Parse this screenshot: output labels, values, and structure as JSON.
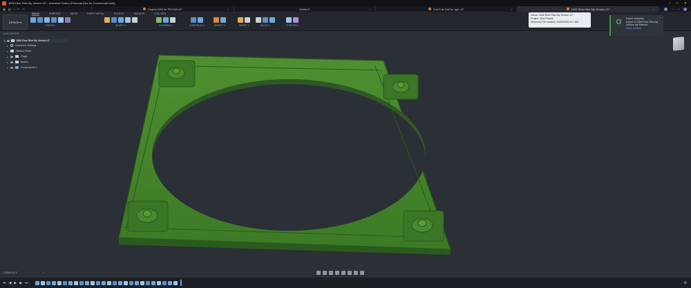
{
  "window": {
    "title": "1606 Rear Ribs My Version v2* - Autodesk Fusion (Personal (Not for Commercial Use))"
  },
  "tabs": [
    {
      "label": "Dayton DS4 for PM Grill v2*",
      "active": false
    },
    {
      "label": "Untitled*",
      "active": false
    },
    {
      "label": "Sch Folk Grill for Igor v7*",
      "active": false
    },
    {
      "label": "1606 Rear Ribs My Version v2*",
      "active": true
    }
  ],
  "ribbon": {
    "workspace": "DESIGN",
    "tabs": [
      "SOLID",
      "SURFACE",
      "MESH",
      "SHEET METAL",
      "PLASTIC",
      "MANAGE",
      "UTILITIES"
    ],
    "active_tab": "SOLID",
    "groups": [
      "CREATE",
      "MODIFY",
      "ASSEMBLE",
      "CONSTRUCT",
      "INSPECT",
      "INSERT",
      "SELECT",
      "POSITION"
    ],
    "groups_display": [
      "CREATE ▾",
      "MODIFY ▾",
      "ASSEMBLE ▾",
      "CONSTRUCT ▾",
      "INSPECT ▾",
      "INSERT ▾",
      "SELECT ▾",
      "POSITION ▾"
    ],
    "group_colors": [
      "#6fa8dc",
      "#e0b050",
      "#7bbf6a",
      "#d98a3a",
      "#c9cfd6",
      "#5aa9ff",
      "#9fc5e8",
      "#b58ad8"
    ]
  },
  "recovery": {
    "name": "Name: 1606 Rear Ribs My Version v2*",
    "project": "Project: New Project",
    "created": "Recovery File created: 12/26/2025 4:17 AM"
  },
  "export_toast": {
    "title": "Export complete",
    "message": "Export of 1606 Rear Ribs My Version.stp finished.",
    "link": "Open location",
    "close": "×"
  },
  "browser": {
    "header": "BROWSER",
    "root": "1606 Rear Ribs My Version v2",
    "items": [
      "Document Settings",
      "Named Views",
      "Origin",
      "Bodies",
      "Component1:1"
    ]
  },
  "comments": {
    "label": "COMMENTS",
    "plus": "+"
  },
  "icons": {
    "app": "fusion-app-icon",
    "window_controls": [
      "minimize-icon",
      "maximize-icon",
      "close-icon"
    ],
    "timeline": [
      "first-icon",
      "previous-icon",
      "play-icon",
      "next-icon",
      "last-icon"
    ]
  },
  "model": {
    "color": "#3f7f2a",
    "edge_color": "#2a5a1d",
    "light_color": "#5a9a3a"
  }
}
